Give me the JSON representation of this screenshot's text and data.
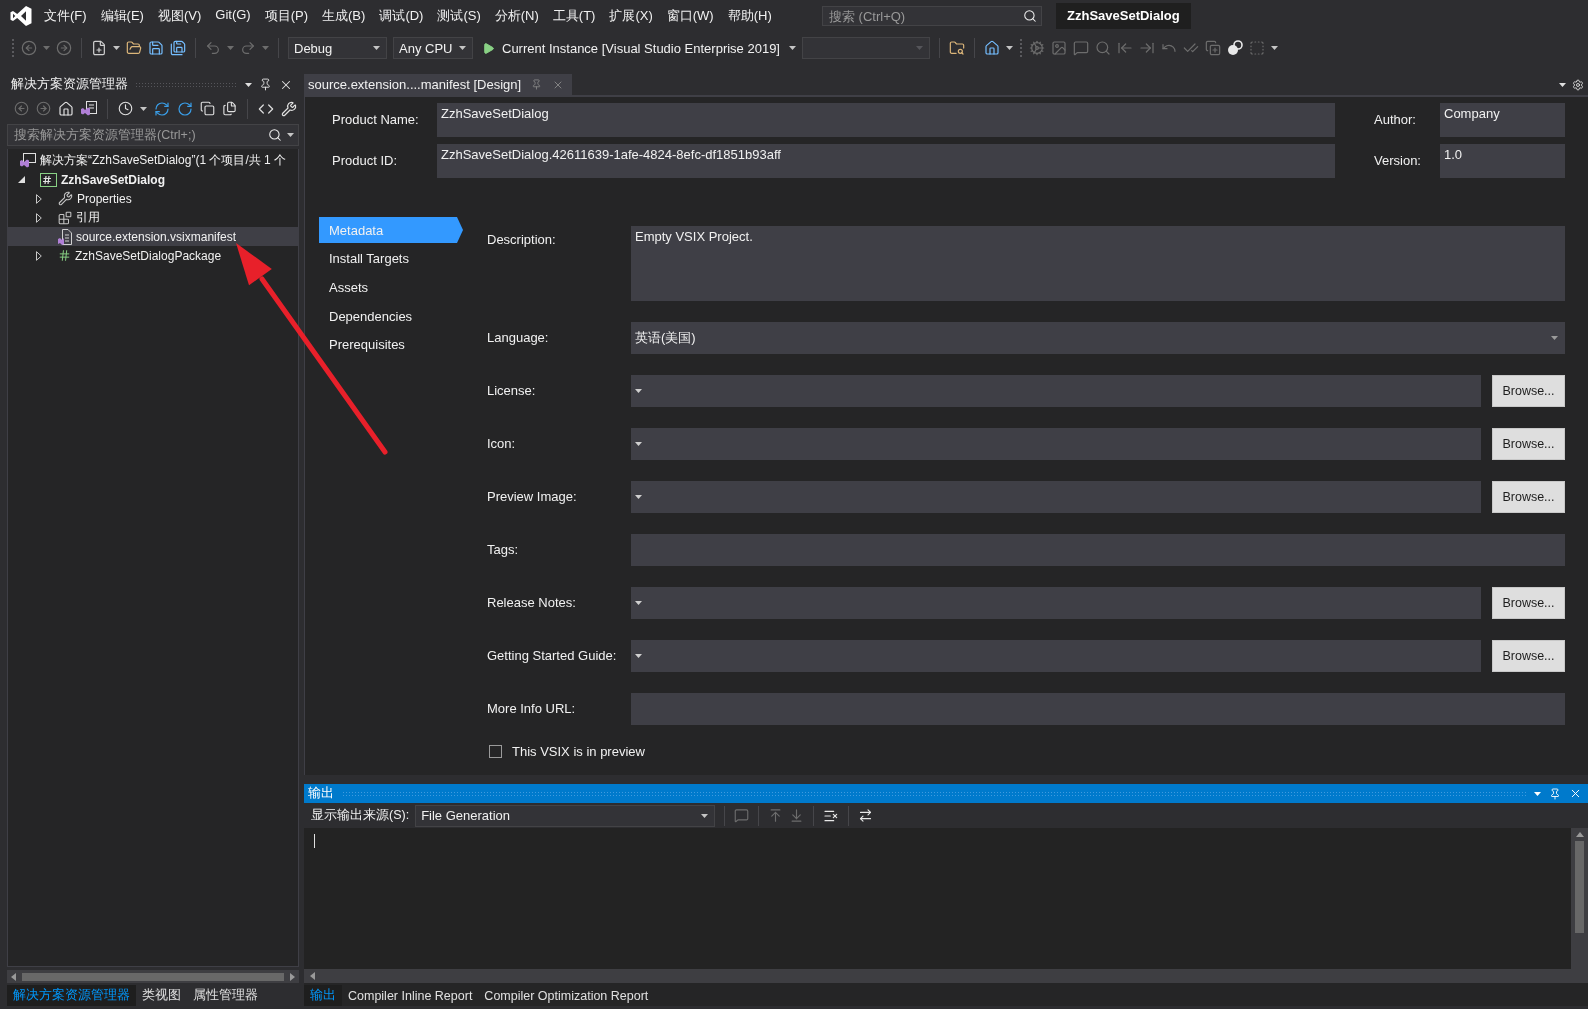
{
  "menu_bar": {
    "items": [
      "文件(F)",
      "编辑(E)",
      "视图(V)",
      "Git(G)",
      "项目(P)",
      "生成(B)",
      "调试(D)",
      "测试(S)",
      "分析(N)",
      "工具(T)",
      "扩展(X)",
      "窗口(W)",
      "帮助(H)"
    ],
    "search": {
      "placeholder": "搜索 (Ctrl+Q)"
    },
    "solution_name": "ZzhSaveSetDialog"
  },
  "toolbar": {
    "configuration": "Debug",
    "platform": "Any CPU",
    "start_target": "Current Instance [Visual Studio Enterprise 2019]"
  },
  "solution_explorer": {
    "title": "解决方案资源管理器",
    "search": {
      "placeholder": "搜索解决方案资源管理器(Ctrl+;)"
    },
    "tree": [
      {
        "label": "解决方案“ZzhSaveSetDialog”(1 个项目/共 1 个",
        "kind": "solution",
        "selected": false,
        "children": [
          {
            "label": "ZzhSaveSetDialog",
            "kind": "project",
            "expanded": true,
            "selected": false,
            "children": [
              {
                "label": "Properties",
                "kind": "properties",
                "expanded": false,
                "selected": false
              },
              {
                "label": "引用",
                "kind": "references",
                "expanded": false,
                "selected": false
              },
              {
                "label": "source.extension.vsixmanifest",
                "kind": "manifest",
                "selected": true
              },
              {
                "label": "ZzhSaveSetDialogPackage",
                "kind": "code",
                "expanded": false,
                "selected": false
              }
            ]
          }
        ]
      }
    ],
    "tabs": [
      {
        "label": "解决方案资源管理器",
        "selected": true
      },
      {
        "label": "类视图",
        "selected": false
      },
      {
        "label": "属性管理器",
        "selected": false
      }
    ]
  },
  "document_tabs": [
    {
      "label": "source.extension....manifest [Design]",
      "selected": true
    }
  ],
  "manifest_editor": {
    "header_rows": [
      {
        "fields": [
          {
            "label": "Product Name:",
            "value": "ZzhSaveSetDialog"
          },
          {
            "label": "Author:",
            "value": "Company"
          }
        ]
      },
      {
        "fields": [
          {
            "label": "Product ID:",
            "value": "ZzhSaveSetDialog.42611639-1afe-4824-8efc-df1851b93aff"
          },
          {
            "label": "Version:",
            "value": "1.0"
          }
        ]
      }
    ],
    "nav": [
      {
        "label": "Metadata",
        "selected": true
      },
      {
        "label": "Install Targets",
        "selected": false
      },
      {
        "label": "Assets",
        "selected": false
      },
      {
        "label": "Dependencies",
        "selected": false
      },
      {
        "label": "Prerequisites",
        "selected": false
      }
    ],
    "fields": [
      {
        "label": "Description:",
        "kind": "multiline",
        "value": "Empty VSIX Project."
      },
      {
        "label": "Language:",
        "kind": "select",
        "value": "英语(美国)"
      },
      {
        "label": "License:",
        "kind": "file",
        "button": "Browse..."
      },
      {
        "label": "Icon:",
        "kind": "file",
        "button": "Browse..."
      },
      {
        "label": "Preview Image:",
        "kind": "file",
        "button": "Browse..."
      },
      {
        "label": "Tags:",
        "kind": "text"
      },
      {
        "label": "Release Notes:",
        "kind": "file",
        "button": "Browse..."
      },
      {
        "label": "Getting Started Guide:",
        "kind": "file",
        "button": "Browse..."
      },
      {
        "label": "More Info URL:",
        "kind": "text"
      }
    ],
    "preview_checkbox": {
      "label": "This VSIX is in preview",
      "checked": false
    }
  },
  "output": {
    "title": "输出",
    "source_label": "显示输出来源(S):",
    "source": "File Generation",
    "tabs": [
      {
        "label": "输出",
        "selected": true
      },
      {
        "label": "Compiler Inline Report",
        "selected": false
      },
      {
        "label": "Compiler Optimization Report",
        "selected": false
      }
    ]
  }
}
